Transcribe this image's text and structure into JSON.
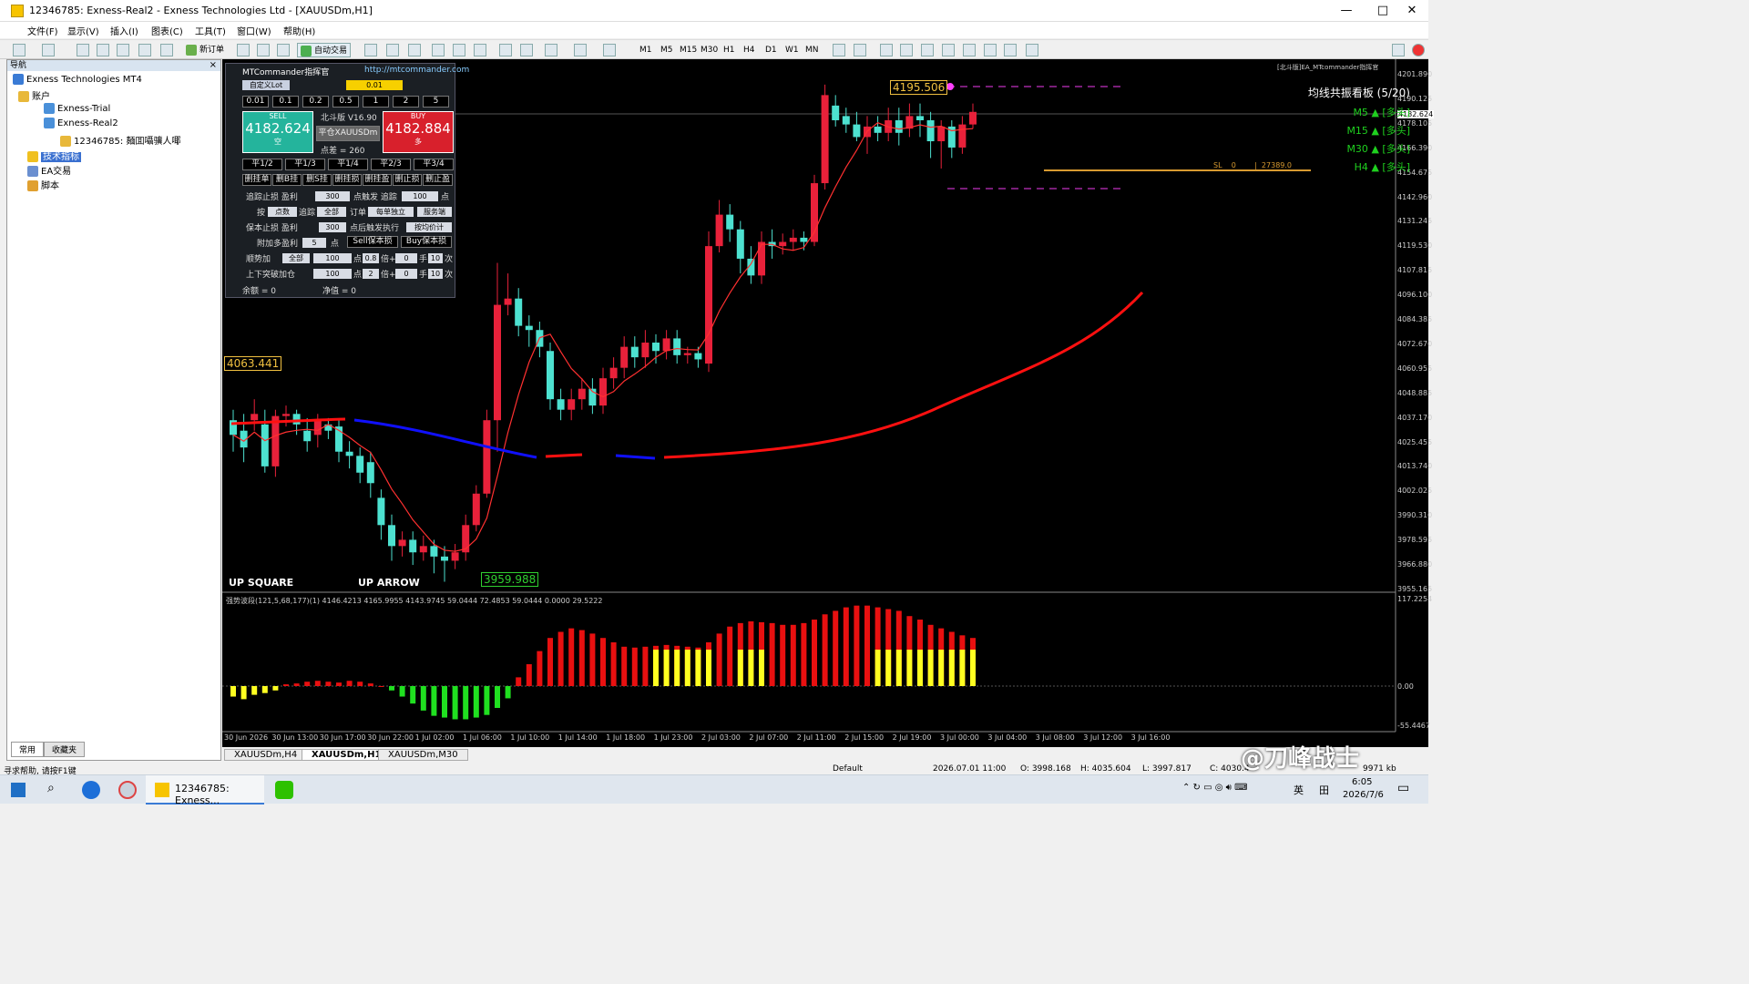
{
  "window": {
    "title": "12346785: Exness-Real2 - Exness Technologies Ltd - [XAUUSDm,H1]",
    "minimize": "—",
    "maximize": "□",
    "close": "✕"
  },
  "menu": [
    "文件(F)",
    "显示(V)",
    "插入(I)",
    "图表(C)",
    "工具(T)",
    "窗口(W)",
    "帮助(H)"
  ],
  "toolbar": {
    "new_order": "新订单",
    "auto_trade": "自动交易",
    "timeframes": [
      "M1",
      "M5",
      "M15",
      "M30",
      "H1",
      "H4",
      "D1",
      "W1",
      "MN"
    ]
  },
  "navigator": {
    "header": "导航",
    "close": "×",
    "items": [
      {
        "label": "Exness Technologies MT4",
        "level": 0
      },
      {
        "label": "账户",
        "level": 1
      },
      {
        "label": "Exness-Trial",
        "level": 2
      },
      {
        "label": "Exness-Real2",
        "level": 2
      },
      {
        "label": "12346785: 麺囬囁骥⼈㖿",
        "level": 3
      },
      {
        "label": "技术指标",
        "level": 1,
        "selected": true
      },
      {
        "label": "EA交易",
        "level": 1
      },
      {
        "label": "脚本",
        "level": 1
      }
    ],
    "tabs": [
      "常用",
      "收藏夹"
    ]
  },
  "mt": {
    "title": "MTCommander指挥官",
    "url": "http://mtcommander.com",
    "lot_mode": "自定义Lot",
    "lot": "0.01",
    "lots": [
      "0.01",
      "0.1",
      "0.2",
      "0.5",
      "1",
      "2",
      "5"
    ],
    "sell_label": "SELL",
    "sell_price": "4182.624",
    "sell_sub": "空",
    "buy_label": "BUY",
    "buy_price": "4182.884",
    "buy_sub": "多",
    "version": "北斗版 V16.90",
    "close_sym": "平仓XAUUSDm",
    "spread": "点差 =   260",
    "partial": [
      "平1/2",
      "平1/3",
      "平1/4",
      "平2/3",
      "平3/4"
    ],
    "del": [
      "删挂单",
      "删B挂",
      "删S挂",
      "删挂损",
      "删挂盈",
      "删止损",
      "删止盈"
    ],
    "r1": {
      "a": "追踪止损",
      "b": "盈利",
      "v1": "300",
      "c": "点触发",
      "d": "追踪",
      "v2": "100",
      "e": "点"
    },
    "r2": {
      "a": "按",
      "b": "点数",
      "c": "追踪",
      "d": "全部",
      "e": "订单",
      "f": "每单独立",
      "g": "服务端"
    },
    "r3": {
      "a": "保本止损",
      "b": "盈利",
      "v": "300",
      "c": "点后触发执行",
      "d": "按均价计"
    },
    "r4": {
      "a": "附加多盈利",
      "v": "5",
      "b": "点",
      "c": "Sell保本损",
      "d": "Buy保本损"
    },
    "r5": {
      "a": "顺势加",
      "b": "全部",
      "v1": "100",
      "c": "点",
      "v2": "0.8",
      "d": "倍+",
      "v3": "0",
      "e": "手",
      "v4": "10",
      "f": "次"
    },
    "r6": {
      "a": "上下突破加仓",
      "v1": "100",
      "c": "点",
      "v2": "2",
      "d": "倍+",
      "v3": "0",
      "e": "手",
      "v4": "10",
      "f": "次"
    },
    "balance": "余额 = 0",
    "equity": "净值 = 0"
  },
  "chart": {
    "label_top": "4195.506",
    "label_left": "4063.441",
    "label_low": "3959.988",
    "up_square": "UP SQUARE",
    "up_arrow": "UP ARROW",
    "ea_tag": "[北斗版]EA_MTcommander指挥官",
    "sl_text": "SL    0        |  27389.0",
    "price_tag": "4182.624",
    "sub_header": "强势波段(121,5,68,177)(1) 4146.4213 4165.9955 4143.9745 59.0444 72.4853 59.0444 0.0000 29.5222",
    "sub_y": [
      "117.2254",
      "0.00",
      "-55.4467"
    ]
  },
  "dashboard": {
    "title": "均线共振看板 (5/20)",
    "rows": [
      {
        "tf": "M5",
        "s": "▲",
        "t": "[多头]"
      },
      {
        "tf": "M15",
        "s": "▲",
        "t": "[多头]"
      },
      {
        "tf": "M30",
        "s": "▲",
        "t": "[多头]"
      },
      {
        "tf": "H4",
        "s": "▲",
        "t": "[多头]"
      }
    ]
  },
  "y_ticks": [
    "4201.890",
    "4190.125",
    "4178.105",
    "4166.390",
    "4154.675",
    "4142.960",
    "4131.245",
    "4119.530",
    "4107.815",
    "4096.100",
    "4084.385",
    "4072.670",
    "4060.955",
    "4048.885",
    "4037.170",
    "4025.455",
    "4013.740",
    "4002.025",
    "3990.310",
    "3978.595",
    "3966.880",
    "3955.165"
  ],
  "x_ticks": [
    "30 Jun 2026",
    "30 Jun 13:00",
    "30 Jun 17:00",
    "30 Jun 22:00",
    "1 Jul 02:00",
    "1 Jul 06:00",
    "1 Jul 10:00",
    "1 Jul 14:00",
    "1 Jul 18:00",
    "1 Jul 23:00",
    "2 Jul 03:00",
    "2 Jul 07:00",
    "2 Jul 11:00",
    "2 Jul 15:00",
    "2 Jul 19:00",
    "3 Jul 00:00",
    "3 Jul 04:00",
    "3 Jul 08:00",
    "3 Jul 12:00",
    "3 Jul 16:00"
  ],
  "chart_tabs": [
    "XAUUSDm,H4",
    "XAUUSDm,H1",
    "XAUUSDm,M30"
  ],
  "status": {
    "help": "寻求帮助, 请按F1键",
    "profile": "Default",
    "time": "2026.07.01 11:00",
    "o": "O: 3998.168",
    "h": "H: 4035.604",
    "l": "L: 3997.817",
    "c": "C: 4030.4",
    "kb": "9971 kb",
    "watermark": "@刀峰战士"
  },
  "taskbar": {
    "app": "12346785: Exness...",
    "lang": "英",
    "time": "6:05",
    "date": "2026/7/6"
  },
  "colors": {
    "up": "#4de1d0",
    "down": "#e8213a",
    "ma_fast": "#ff3030",
    "ma_slow": "#ff1010",
    "blue": "#1010ff",
    "osc_up": "#e81010",
    "osc_yel": "#ffff20",
    "osc_dn": "#20e020"
  }
}
